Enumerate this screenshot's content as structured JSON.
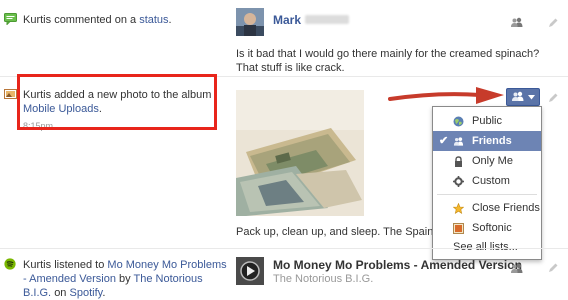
{
  "stories": [
    {
      "actor": "Kurtis",
      "action": "commented on a",
      "object": "status",
      "suffix": ".",
      "poster_name": "Mark",
      "comment_line1": "Is it bad that I would go there mainly for the creamed spinach?",
      "comment_line2": "That stuff is like crack."
    },
    {
      "actor": "Kurtis",
      "action": "added a new photo to the album",
      "object": "Mobile Uploads",
      "suffix": ".",
      "time": "8:15pm",
      "caption": "Pack up, clean up, and sleep. The Spain Train le"
    },
    {
      "actor": "Kurtis",
      "action": "listened to",
      "object": "Mo Money Mo Problems - Amended Version",
      "by_text": "by",
      "artist": "The Notorious B.I.G.",
      "on_text": "on",
      "service": "Spotify",
      "suffix": ".",
      "song_title": "Mo Money Mo Problems - Amended Version",
      "song_artist": "The Notorious B.I.G."
    }
  ],
  "audience_menu": {
    "items": [
      {
        "label": "Public",
        "icon": "globe-icon",
        "selected": false
      },
      {
        "label": "Friends",
        "icon": "friends-icon",
        "selected": true
      },
      {
        "label": "Only Me",
        "icon": "lock-icon",
        "selected": false
      },
      {
        "label": "Custom",
        "icon": "gear-icon",
        "selected": false
      },
      {
        "label": "Softonic",
        "icon": "list-icon",
        "selected": false
      },
      {
        "label": "Close Friends",
        "icon": "star-list-icon",
        "selected": false
      },
      {
        "label": "Softonic",
        "icon": "list-icon",
        "selected": false
      },
      {
        "label": "See all lists...",
        "icon": "",
        "selected": false
      }
    ]
  },
  "colors": {
    "link": "#3b5998",
    "highlight_box": "#e8251b",
    "arrow": "#c73b2b",
    "menu_selected": "#6d84b4",
    "audience_button": "#5b74a8"
  }
}
